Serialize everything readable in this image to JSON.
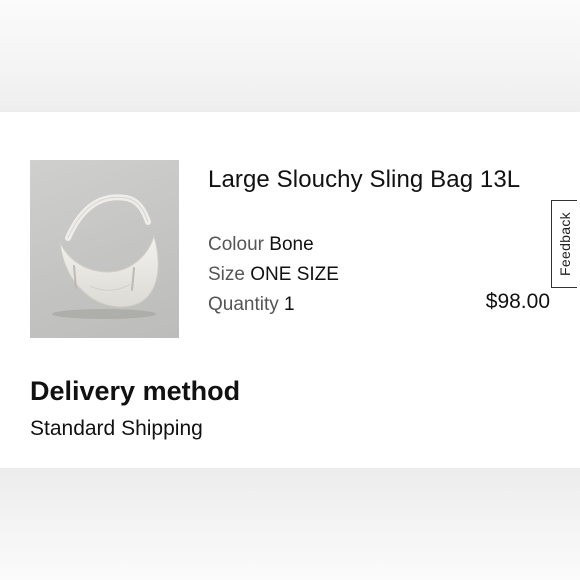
{
  "product": {
    "name": "Large Slouchy Sling Bag 13L",
    "colour_label": "Colour",
    "colour_value": "Bone",
    "size_label": "Size",
    "size_value": "ONE SIZE",
    "quantity_label": "Quantity",
    "quantity_value": "1",
    "price": "$98.00",
    "image_icon": "bag-product-image"
  },
  "delivery": {
    "heading": "Delivery method",
    "value": "Standard Shipping"
  },
  "feedback": {
    "label": "Feedback"
  },
  "colors": {
    "background": "#f2f2f2",
    "card": "#ffffff",
    "text": "#111111",
    "muted_label": "#555555",
    "thumbnail_bg": "#c4c4c2"
  }
}
